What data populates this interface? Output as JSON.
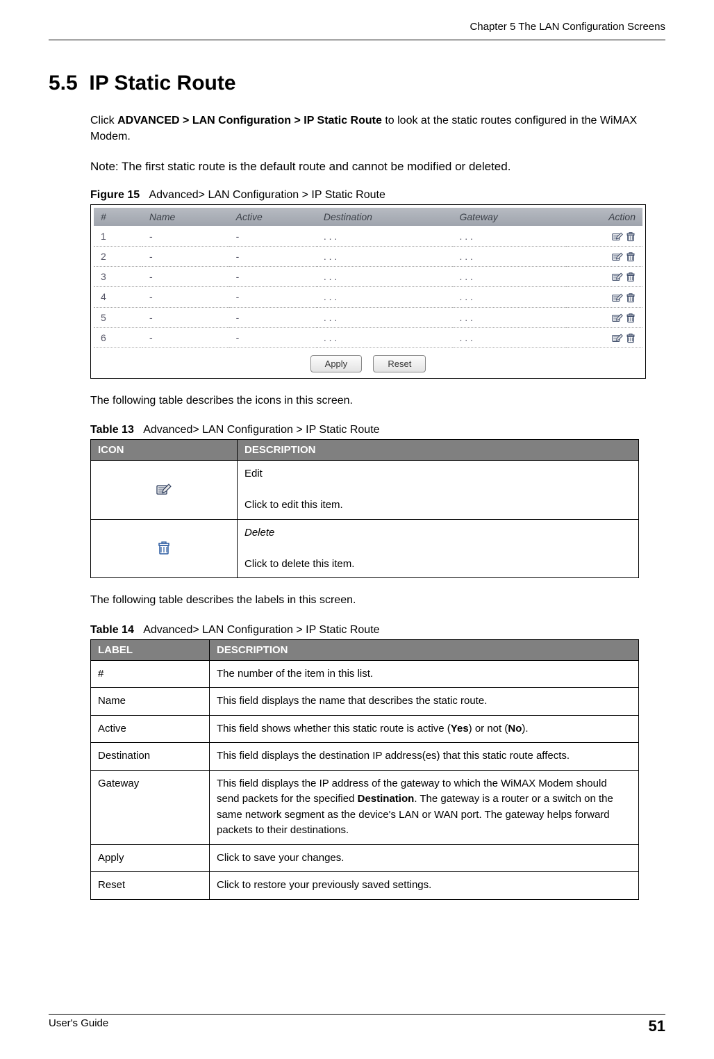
{
  "header": {
    "chapter": "Chapter 5 The LAN Configuration Screens"
  },
  "section": {
    "number": "5.5",
    "title": "IP Static Route"
  },
  "intro": {
    "prefix": "Click ",
    "path": "ADVANCED > LAN Configuration > IP Static Route",
    "suffix": " to look at the static routes configured in the WiMAX Modem."
  },
  "note": "Note: The first static route is the default route and cannot be modified or deleted.",
  "figure": {
    "label": "Figure 15",
    "caption": "Advanced> LAN Configuration > IP Static Route"
  },
  "routes": {
    "headers": {
      "num": "#",
      "name": "Name",
      "active": "Active",
      "dest": "Destination",
      "gw": "Gateway",
      "action": "Action"
    },
    "rows": [
      {
        "num": "1",
        "name": "-",
        "active": "-",
        "dest": ". . .",
        "gw": ". . ."
      },
      {
        "num": "2",
        "name": "-",
        "active": "-",
        "dest": ". . .",
        "gw": ". . ."
      },
      {
        "num": "3",
        "name": "-",
        "active": "-",
        "dest": ". . .",
        "gw": ". . ."
      },
      {
        "num": "4",
        "name": "-",
        "active": "-",
        "dest": ". . .",
        "gw": ". . ."
      },
      {
        "num": "5",
        "name": "-",
        "active": "-",
        "dest": ". . .",
        "gw": ". . ."
      },
      {
        "num": "6",
        "name": "-",
        "active": "-",
        "dest": ". . .",
        "gw": ". . ."
      }
    ],
    "buttons": {
      "apply": "Apply",
      "reset": "Reset"
    }
  },
  "icons_intro": "The following table describes the icons in this screen.",
  "table13": {
    "label": "Table 13",
    "caption": "Advanced> LAN Configuration > IP Static Route",
    "head": {
      "icon": "ICON",
      "desc": "DESCRIPTION"
    },
    "rows": [
      {
        "name": "Edit",
        "desc": "Click to edit this item."
      },
      {
        "name": "Delete",
        "desc": "Click to delete this item."
      }
    ]
  },
  "labels_intro": "The following table describes the labels in this screen.",
  "table14": {
    "label": "Table 14",
    "caption": "Advanced> LAN Configuration > IP Static Route",
    "head": {
      "label": "LABEL",
      "desc": "DESCRIPTION"
    },
    "rows": [
      {
        "label": "#",
        "desc": "The number of the item in this list."
      },
      {
        "label": "Name",
        "desc": "This field displays the name that describes the static route."
      },
      {
        "label": "Active",
        "desc_pre": "This field shows whether this static route is active (",
        "b1": "Yes",
        "mid": ") or not (",
        "b2": "No",
        "post": ")."
      },
      {
        "label": "Destination",
        "desc": "This field displays the destination IP address(es) that this static route affects."
      },
      {
        "label": "Gateway",
        "desc_pre": "This field displays the IP address of the gateway to which the WiMAX Modem should send packets for the specified ",
        "b1": "Destination",
        "post": ". The gateway is a router or a switch on the same network segment as the device's LAN or WAN port. The gateway helps forward packets to their destinations."
      },
      {
        "label": "Apply",
        "desc": "Click to save your changes."
      },
      {
        "label": "Reset",
        "desc": "Click to restore your previously saved settings."
      }
    ]
  },
  "footer": {
    "guide": "User's Guide",
    "page": "51"
  }
}
